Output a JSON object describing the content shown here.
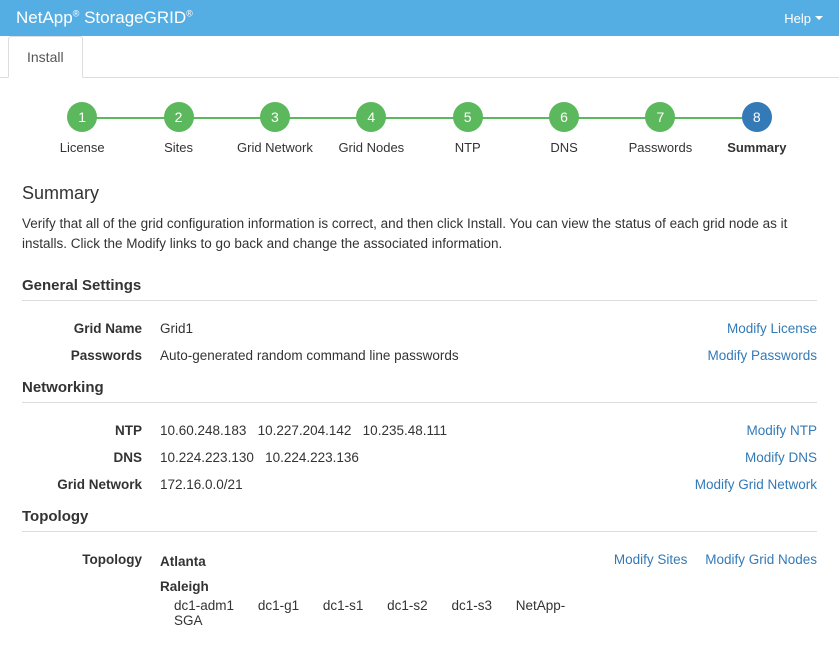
{
  "brand": {
    "left": "NetApp",
    "right": "StorageGRID",
    "reg": "®"
  },
  "help": {
    "label": "Help"
  },
  "tab": {
    "install": "Install"
  },
  "steps": [
    {
      "num": "1",
      "label": "License"
    },
    {
      "num": "2",
      "label": "Sites"
    },
    {
      "num": "3",
      "label": "Grid Network"
    },
    {
      "num": "4",
      "label": "Grid Nodes"
    },
    {
      "num": "5",
      "label": "NTP"
    },
    {
      "num": "6",
      "label": "DNS"
    },
    {
      "num": "7",
      "label": "Passwords"
    },
    {
      "num": "8",
      "label": "Summary"
    }
  ],
  "page": {
    "title": "Summary",
    "intro": "Verify that all of the grid configuration information is correct, and then click Install. You can view the status of each grid node as it installs. Click the Modify links to go back and change the associated information."
  },
  "sections": {
    "general": {
      "title": "General Settings",
      "grid_name_label": "Grid Name",
      "grid_name_value": "Grid1",
      "grid_name_action": "Modify License",
      "passwords_label": "Passwords",
      "passwords_value": "Auto-generated random command line passwords",
      "passwords_action": "Modify Passwords"
    },
    "networking": {
      "title": "Networking",
      "ntp_label": "NTP",
      "ntp_value": "10.60.248.183   10.227.204.142   10.235.48.111",
      "ntp_action": "Modify NTP",
      "dns_label": "DNS",
      "dns_value": "10.224.223.130   10.224.223.136",
      "dns_action": "Modify DNS",
      "gridnet_label": "Grid Network",
      "gridnet_value": "172.16.0.0/21",
      "gridnet_action": "Modify Grid Network"
    },
    "topology": {
      "title": "Topology",
      "label": "Topology",
      "action_sites": "Modify Sites",
      "action_nodes": "Modify Grid Nodes",
      "site1": "Atlanta",
      "site2": "Raleigh",
      "nodes": {
        "n0": "dc1-adm1",
        "n1": "dc1-g1",
        "n2": "dc1-s1",
        "n3": "dc1-s2",
        "n4": "dc1-s3",
        "n5": "NetApp-SGA"
      }
    }
  }
}
